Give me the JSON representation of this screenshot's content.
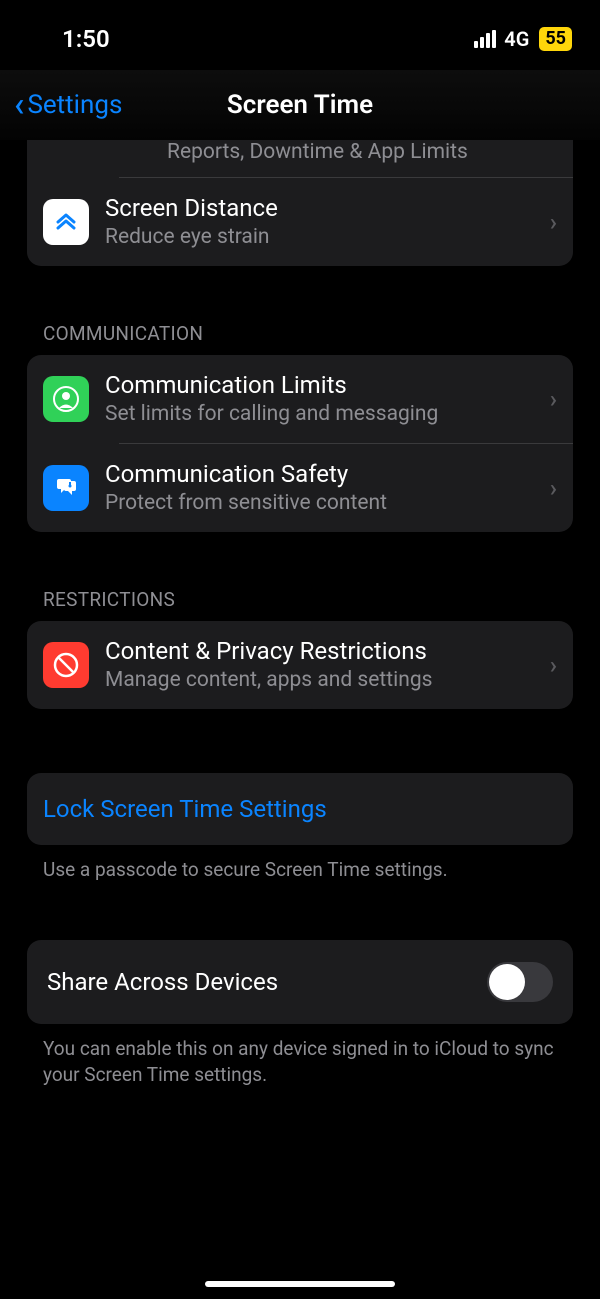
{
  "status": {
    "time": "1:50",
    "network": "4G",
    "battery": "55"
  },
  "nav": {
    "back": "Settings",
    "title": "Screen Time"
  },
  "partial_row": {
    "sub": "Reports, Downtime & App Limits"
  },
  "top_group": {
    "screen_distance": {
      "title": "Screen Distance",
      "sub": "Reduce eye strain"
    }
  },
  "communication": {
    "header": "COMMUNICATION",
    "limits": {
      "title": "Communication Limits",
      "sub": "Set limits for calling and messaging"
    },
    "safety": {
      "title": "Communication Safety",
      "sub": "Protect from sensitive content"
    }
  },
  "restrictions": {
    "header": "RESTRICTIONS",
    "content_privacy": {
      "title": "Content & Privacy Restrictions",
      "sub": "Manage content, apps and settings"
    }
  },
  "lock": {
    "title": "Lock Screen Time Settings",
    "footer": "Use a passcode to secure Screen Time settings."
  },
  "share": {
    "title": "Share Across Devices",
    "footer": "You can enable this on any device signed in to iCloud to sync your Screen Time settings."
  }
}
